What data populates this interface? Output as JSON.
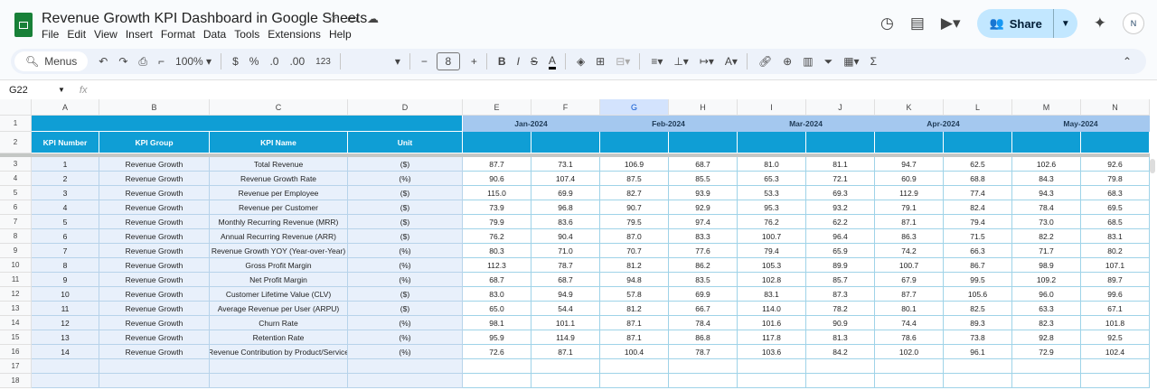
{
  "app": {
    "title": "Revenue Growth KPI Dashboard in Google Sheets",
    "menu": [
      "File",
      "Edit",
      "View",
      "Insert",
      "Format",
      "Data",
      "Tools",
      "Extensions",
      "Help"
    ],
    "share_label": "Share",
    "avatar_text": "N"
  },
  "toolbar": {
    "menus_label": "Menus",
    "zoom": "100%",
    "currency": "$",
    "percent": "%",
    "dec_decrease": ".0",
    "dec_increase": ".00",
    "number_format": "123",
    "font_size": "8"
  },
  "formula_bar": {
    "cell_ref": "G22",
    "fx": "fx",
    "value": ""
  },
  "columns": [
    "A",
    "B",
    "C",
    "D",
    "E",
    "F",
    "G",
    "H",
    "I",
    "J",
    "K",
    "L",
    "M",
    "N"
  ],
  "selected_column": "G",
  "months": [
    "Jan-2024",
    "Feb-2024",
    "Mar-2024",
    "Apr-2024",
    "May-2024"
  ],
  "headers": [
    "KPI Number",
    "KPI Group",
    "KPI Name",
    "Unit"
  ],
  "rows": [
    {
      "num": "1",
      "group": "Revenue Growth",
      "name": "Total Revenue",
      "unit": "($)",
      "vals": [
        "87.7",
        "73.1",
        "106.9",
        "68.7",
        "81.0",
        "81.1",
        "94.7",
        "62.5",
        "102.6",
        "92.6"
      ]
    },
    {
      "num": "2",
      "group": "Revenue Growth",
      "name": "Revenue Growth Rate",
      "unit": "(%)",
      "vals": [
        "90.6",
        "107.4",
        "87.5",
        "85.5",
        "65.3",
        "72.1",
        "60.9",
        "68.8",
        "84.3",
        "79.8"
      ]
    },
    {
      "num": "3",
      "group": "Revenue Growth",
      "name": "Revenue per Employee",
      "unit": "($)",
      "vals": [
        "115.0",
        "69.9",
        "82.7",
        "93.9",
        "53.3",
        "69.3",
        "112.9",
        "77.4",
        "94.3",
        "68.3"
      ]
    },
    {
      "num": "4",
      "group": "Revenue Growth",
      "name": "Revenue per Customer",
      "unit": "($)",
      "vals": [
        "73.9",
        "96.8",
        "90.7",
        "92.9",
        "95.3",
        "93.2",
        "79.1",
        "82.4",
        "78.4",
        "69.5"
      ]
    },
    {
      "num": "5",
      "group": "Revenue Growth",
      "name": "Monthly Recurring Revenue (MRR)",
      "unit": "($)",
      "vals": [
        "79.9",
        "83.6",
        "79.5",
        "97.4",
        "76.2",
        "62.2",
        "87.1",
        "79.4",
        "73.0",
        "68.5"
      ]
    },
    {
      "num": "6",
      "group": "Revenue Growth",
      "name": "Annual Recurring Revenue (ARR)",
      "unit": "($)",
      "vals": [
        "76.2",
        "90.4",
        "87.0",
        "83.3",
        "100.7",
        "96.4",
        "86.3",
        "71.5",
        "82.2",
        "83.1"
      ]
    },
    {
      "num": "7",
      "group": "Revenue Growth",
      "name": "Revenue Growth YOY (Year-over-Year)",
      "unit": "(%)",
      "vals": [
        "80.3",
        "71.0",
        "70.7",
        "77.6",
        "79.4",
        "65.9",
        "74.2",
        "66.3",
        "71.7",
        "80.2"
      ]
    },
    {
      "num": "8",
      "group": "Revenue Growth",
      "name": "Gross Profit Margin",
      "unit": "(%)",
      "vals": [
        "112.3",
        "78.7",
        "81.2",
        "86.2",
        "105.3",
        "89.9",
        "100.7",
        "86.7",
        "98.9",
        "107.1"
      ]
    },
    {
      "num": "9",
      "group": "Revenue Growth",
      "name": "Net Profit Margin",
      "unit": "(%)",
      "vals": [
        "68.7",
        "68.7",
        "94.8",
        "83.5",
        "102.8",
        "85.7",
        "67.9",
        "99.5",
        "109.2",
        "89.7"
      ]
    },
    {
      "num": "10",
      "group": "Revenue Growth",
      "name": "Customer Lifetime Value (CLV)",
      "unit": "($)",
      "vals": [
        "83.0",
        "94.9",
        "57.8",
        "69.9",
        "83.1",
        "87.3",
        "87.7",
        "105.6",
        "96.0",
        "99.6"
      ]
    },
    {
      "num": "11",
      "group": "Revenue Growth",
      "name": "Average Revenue per User (ARPU)",
      "unit": "($)",
      "vals": [
        "65.0",
        "54.4",
        "81.2",
        "66.7",
        "114.0",
        "78.2",
        "80.1",
        "82.5",
        "63.3",
        "67.1"
      ]
    },
    {
      "num": "12",
      "group": "Revenue Growth",
      "name": "Churn Rate",
      "unit": "(%)",
      "vals": [
        "98.1",
        "101.1",
        "87.1",
        "78.4",
        "101.6",
        "90.9",
        "74.4",
        "89.3",
        "82.3",
        "101.8"
      ]
    },
    {
      "num": "13",
      "group": "Revenue Growth",
      "name": "Retention Rate",
      "unit": "(%)",
      "vals": [
        "95.9",
        "114.9",
        "87.1",
        "86.8",
        "117.8",
        "81.3",
        "78.6",
        "73.8",
        "92.8",
        "92.5"
      ]
    },
    {
      "num": "14",
      "group": "Revenue Growth",
      "name": "Revenue Contribution by Product/Service",
      "unit": "(%)",
      "vals": [
        "72.6",
        "87.1",
        "100.4",
        "78.7",
        "103.6",
        "84.2",
        "102.0",
        "96.1",
        "72.9",
        "102.4"
      ]
    }
  ],
  "row_numbers": [
    "1",
    "2",
    "3",
    "4",
    "5",
    "6",
    "7",
    "8",
    "9",
    "10",
    "11",
    "12",
    "13",
    "14",
    "15",
    "16",
    "17",
    "18"
  ]
}
